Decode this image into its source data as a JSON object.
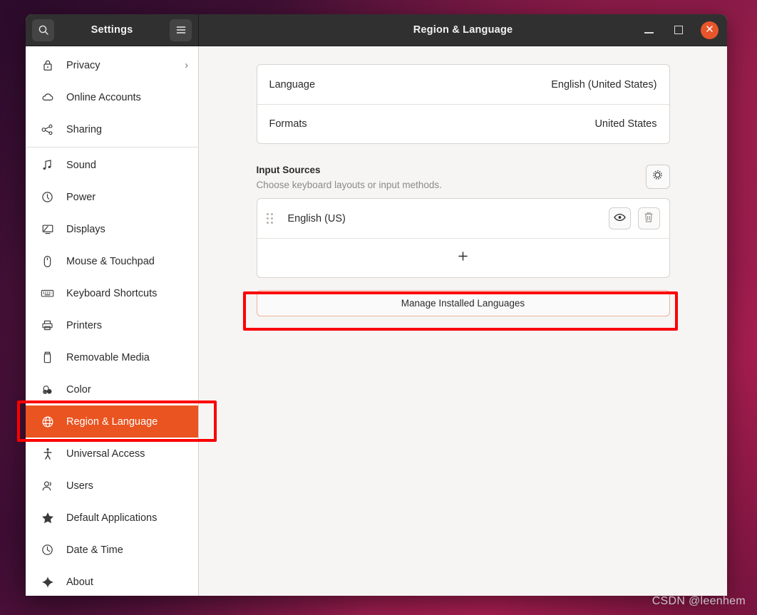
{
  "window": {
    "app_title": "Settings",
    "page_title": "Region & Language",
    "search_icon": "search-icon",
    "menu_icon": "hamburger-menu-icon",
    "minimize_label": "Minimize",
    "maximize_label": "Maximize",
    "close_label": "Close",
    "close_color": "#e9552b"
  },
  "sidebar": {
    "selected": "Region & Language",
    "accent_color": "#e95420",
    "items": [
      {
        "label": "Privacy",
        "icon": "lock-icon",
        "chevron": "›"
      },
      {
        "label": "Online Accounts",
        "icon": "cloud-icon"
      },
      {
        "label": "Sharing",
        "icon": "share-nodes-icon"
      },
      {
        "label": "Sound",
        "icon": "music-note-icon"
      },
      {
        "label": "Power",
        "icon": "power-icon"
      },
      {
        "label": "Displays",
        "icon": "display-icon"
      },
      {
        "label": "Mouse & Touchpad",
        "icon": "mouse-icon"
      },
      {
        "label": "Keyboard Shortcuts",
        "icon": "keyboard-icon"
      },
      {
        "label": "Printers",
        "icon": "printer-icon"
      },
      {
        "label": "Removable Media",
        "icon": "usb-drive-icon"
      },
      {
        "label": "Color",
        "icon": "color-circles-icon"
      },
      {
        "label": "Region & Language",
        "icon": "globe-icon"
      },
      {
        "label": "Universal Access",
        "icon": "accessibility-icon"
      },
      {
        "label": "Users",
        "icon": "users-icon"
      },
      {
        "label": "Default Applications",
        "icon": "star-icon"
      },
      {
        "label": "Date & Time",
        "icon": "clock-icon"
      },
      {
        "label": "About",
        "icon": "sparkle-icon"
      }
    ]
  },
  "main": {
    "language_row": {
      "label": "Language",
      "value": "English (United States)"
    },
    "formats_row": {
      "label": "Formats",
      "value": "United States"
    },
    "input_sources": {
      "title": "Input Sources",
      "subtitle": "Choose keyboard layouts or input methods.",
      "options_icon": "gear-icon",
      "sources": [
        {
          "label": "English (US)",
          "drag_icon": "drag-handle-icon",
          "preview_icon": "eye-icon",
          "remove_icon": "trash-icon"
        }
      ],
      "add_icon": "plus-icon"
    },
    "manage_button": "Manage Installed Languages"
  },
  "annotations": {
    "color": "#fb0000",
    "boxes": [
      {
        "name": "sidebar-region-language-highlight"
      },
      {
        "name": "manage-installed-languages-highlight"
      }
    ]
  },
  "watermark": "CSDN @leenhem"
}
